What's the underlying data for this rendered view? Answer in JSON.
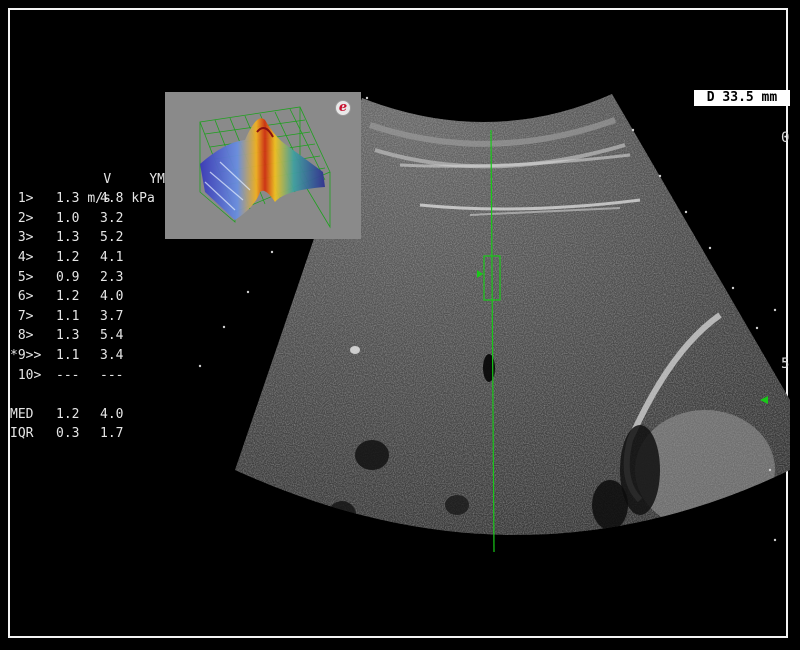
{
  "measure_table": {
    "header_1": [
      "",
      "V",
      "YM"
    ],
    "header_2": [
      "",
      "m/s",
      "kPa"
    ],
    "rows": [
      {
        "id": " 1>",
        "v": "1.3",
        "ym": "4.8"
      },
      {
        "id": " 2>",
        "v": "1.0",
        "ym": "3.2"
      },
      {
        "id": " 3>",
        "v": "1.3",
        "ym": "5.2"
      },
      {
        "id": " 4>",
        "v": "1.2",
        "ym": "4.1"
      },
      {
        "id": " 5>",
        "v": "0.9",
        "ym": "2.3"
      },
      {
        "id": " 6>",
        "v": "1.2",
        "ym": "4.0"
      },
      {
        "id": " 7>",
        "v": "1.1",
        "ym": "3.7"
      },
      {
        "id": " 8>",
        "v": "1.3",
        "ym": "5.4"
      },
      {
        "id": "*9>>",
        "v": "1.1",
        "ym": "3.4"
      },
      {
        "id": " 10>",
        "v": "---",
        "ym": "---"
      }
    ],
    "summary": [
      {
        "id": "MED",
        "v": "1.2",
        "ym": "4.0"
      },
      {
        "id": "IQR",
        "v": "0.3",
        "ym": "1.7"
      }
    ]
  },
  "depth_label": "D 33.5 mm",
  "depth_scale": [
    "0",
    "5"
  ],
  "logo_letter": "e",
  "colors": {
    "background": "#000000",
    "frame": "#f2f2f2",
    "marker_line": "#19c819",
    "text": "#e6e6e6"
  },
  "icons": [
    "elastography-3d-plot",
    "e-logo",
    "focus-marker-arrow",
    "roi-box"
  ]
}
